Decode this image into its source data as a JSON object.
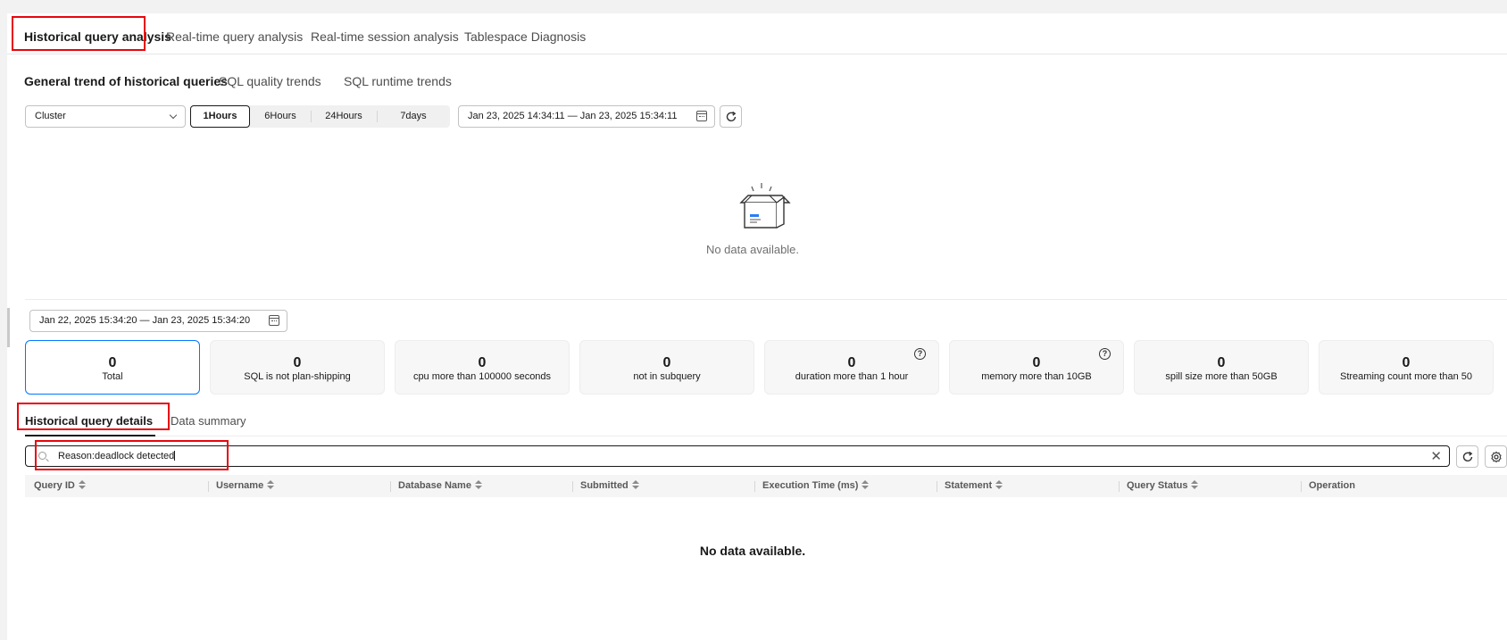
{
  "top_tabs": [
    "Historical query analysis",
    "Real-time query analysis",
    "Real-time session analysis",
    "Tablespace Diagnosis"
  ],
  "sub_tabs": [
    "General trend of historical queries",
    "SQL quality trends",
    "SQL runtime trends"
  ],
  "filters": {
    "scope": "Cluster",
    "ranges": [
      "1Hours",
      "6Hours",
      "24Hours",
      "7days"
    ],
    "selected_range": "1Hours",
    "trend_range": "Jan 23, 2025 14:34:11 — Jan 23, 2025 15:34:11"
  },
  "chart_empty": "No data available.",
  "details_range": "Jan 22, 2025 15:34:20 — Jan 23, 2025 15:34:20",
  "stats": [
    {
      "value": "0",
      "label": "Total"
    },
    {
      "value": "0",
      "label": "SQL is not plan-shipping"
    },
    {
      "value": "0",
      "label": "cpu more than 100000 seconds"
    },
    {
      "value": "0",
      "label": "not in subquery"
    },
    {
      "value": "0",
      "label": "duration more than 1 hour"
    },
    {
      "value": "0",
      "label": "memory more than 10GB"
    },
    {
      "value": "0",
      "label": "spill size more than 50GB"
    },
    {
      "value": "0",
      "label": "Streaming count more than 50"
    }
  ],
  "detail_tabs": [
    "Historical query details",
    "Data summary"
  ],
  "search": {
    "value": "Reason:deadlock detected"
  },
  "columns": [
    "Query ID",
    "Username",
    "Database Name",
    "Submitted",
    "Execution Time (ms)",
    "Statement",
    "Query Status",
    "Operation"
  ],
  "table_empty": "No data available.",
  "colors": {
    "accent": "#0077ff",
    "highlight": "#e6060c",
    "illustration": "#2b7cf6"
  }
}
